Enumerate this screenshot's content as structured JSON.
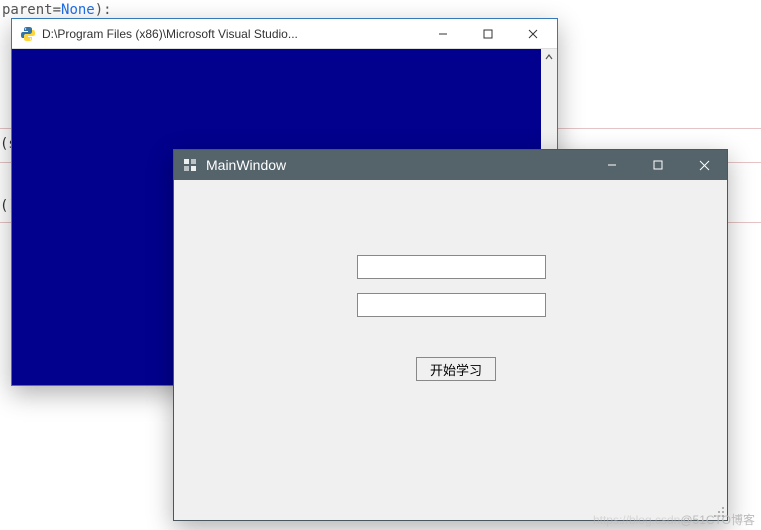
{
  "code_background": {
    "line1_prefix": "parent=",
    "line1_value": "None",
    "line1_suffix": "):",
    "fragment_s": "(s",
    "fragment_paren": "()"
  },
  "back_window": {
    "title": "D:\\Program Files (x86)\\Microsoft Visual Studio...",
    "icon_name": "python-icon"
  },
  "front_window": {
    "title": "MainWindow",
    "input1_value": "",
    "input2_value": "",
    "button_label": "开始学习"
  },
  "watermark": "@51CTO博客"
}
